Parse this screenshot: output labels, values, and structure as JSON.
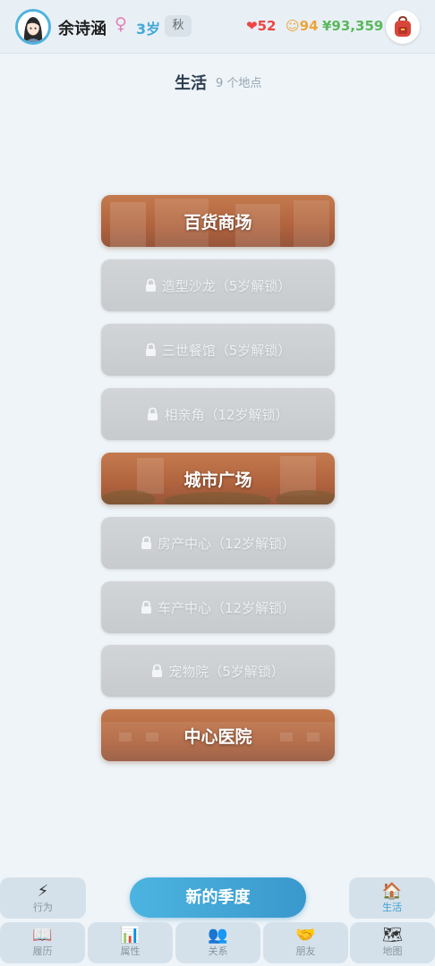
{
  "header": {
    "name": "余诗涵",
    "gender_symbol": "♀",
    "age": "3岁",
    "season": "秋",
    "health": "❤52",
    "mood": "☺94",
    "money": "¥93,359"
  },
  "section": {
    "title": "生活",
    "count": "9 个地点"
  },
  "locations": [
    {
      "label": "百货商场",
      "locked": false
    },
    {
      "label": "造型沙龙（5岁解锁）",
      "locked": true
    },
    {
      "label": "三世餐馆（5岁解锁）",
      "locked": true
    },
    {
      "label": "相亲角（12岁解锁）",
      "locked": true
    },
    {
      "label": "城市广场",
      "locked": false
    },
    {
      "label": "房产中心（12岁解锁）",
      "locked": true
    },
    {
      "label": "车产中心（12岁解锁）",
      "locked": true
    },
    {
      "label": "宠物院（5岁解锁）",
      "locked": true
    },
    {
      "label": "中心医院",
      "locked": false
    }
  ],
  "bottom": {
    "action": {
      "icon": "⚡",
      "label": "行为"
    },
    "new_season": "新的季度",
    "life": {
      "icon": "🏠",
      "label": "生活"
    },
    "tabs": [
      {
        "icon": "📖",
        "label": "履历"
      },
      {
        "icon": "📊",
        "label": "属性"
      },
      {
        "icon": "👥",
        "label": "关系"
      },
      {
        "icon": "🤝",
        "label": "朋友"
      },
      {
        "icon": "🗺",
        "label": "地图"
      }
    ]
  },
  "colors": {
    "accent": "#45a8d8",
    "active_card": "#b0633d",
    "locked_card": "#cbced1",
    "health": "#e44444",
    "mood": "#eea43a",
    "money": "#5bb85b"
  }
}
